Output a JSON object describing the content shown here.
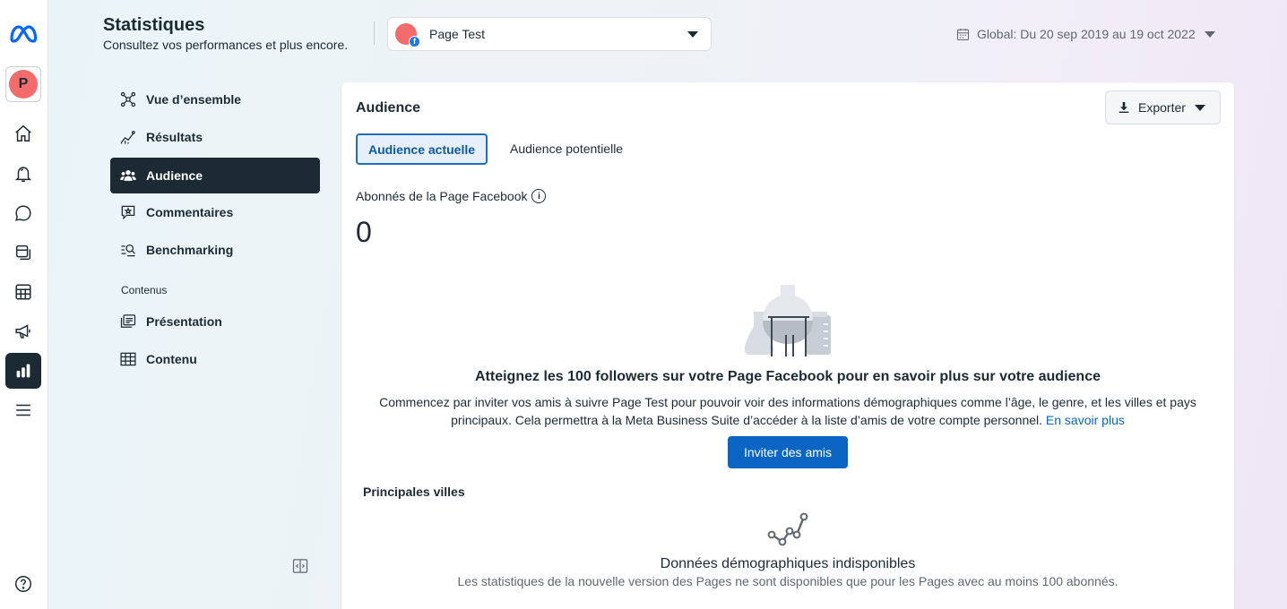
{
  "header": {
    "title": "Statistiques",
    "subtitle": "Consultez vos performances et plus encore.",
    "page_selector": {
      "label": "Page Test",
      "avatar_badge": "f"
    },
    "date_range": "Global: Du 20 sep 2019 au 19 oct 2022"
  },
  "rail": {
    "avatar_letter": "P",
    "items": [
      "meta-logo-icon",
      "home-icon",
      "bell-icon",
      "chat-icon",
      "pages-icon",
      "table-icon",
      "megaphone-icon",
      "insights-icon",
      "menu-icon",
      "help-icon"
    ]
  },
  "nav": {
    "items": [
      {
        "label": "Vue d’ensemble",
        "icon": "overview-icon"
      },
      {
        "label": "Résultats",
        "icon": "results-icon"
      },
      {
        "label": "Audience",
        "icon": "audience-icon",
        "active": true
      },
      {
        "label": "Commentaires",
        "icon": "comments-icon"
      },
      {
        "label": "Benchmarking",
        "icon": "benchmarking-icon"
      }
    ],
    "section_heading": "Contenus",
    "content_items": [
      {
        "label": "Présentation",
        "icon": "presentation-icon"
      },
      {
        "label": "Contenu",
        "icon": "content-table-icon"
      }
    ]
  },
  "card": {
    "title": "Audience",
    "export_label": "Exporter",
    "tabs": {
      "current": "Audience actuelle",
      "potential": "Audience potentielle"
    },
    "followers_label": "Abonnés de la Page Facebook",
    "info_glyph": "i",
    "followers_count": "0",
    "empty_title": "Atteignez les 100 followers sur votre Page Facebook pour en savoir plus sur votre audience",
    "empty_text": "Commencez par inviter vos amis à suivre Page Test pour pouvoir voir des informations démographiques comme l’âge, le genre, et les villes et pays principaux. Cela permettra à la Meta Business Suite d’accéder à la liste d’amis de votre compte personnel.",
    "learn_more": "En savoir plus",
    "invite_label": "Inviter des amis",
    "cities_label": "Principales villes",
    "demo_title": "Données démographiques indisponibles",
    "demo_text": "Les statistiques de la nouvelle version des Pages ne sont disponibles que pour les Pages avec au moins 100 abonnés."
  },
  "colors": {
    "accent": "#0a66c2",
    "dark": "#1c2b33",
    "avatar": "#f36b6b",
    "facebook": "#1877f2"
  }
}
